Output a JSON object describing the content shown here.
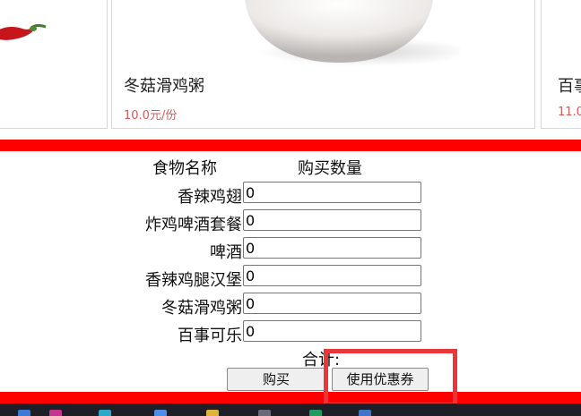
{
  "products": [
    {
      "name": "",
      "price": ""
    },
    {
      "name": "冬菇滑鸡粥",
      "price": "10.0元/份"
    },
    {
      "name": "百事",
      "price": "11.0"
    }
  ],
  "order": {
    "col_name": "食物名称",
    "col_qty": "购买数量",
    "items": [
      {
        "name": "香辣鸡翅",
        "qty": "0"
      },
      {
        "name": "炸鸡啤酒套餐",
        "qty": "0"
      },
      {
        "name": "啤酒",
        "qty": "0"
      },
      {
        "name": "香辣鸡腿汉堡",
        "qty": "0"
      },
      {
        "name": "冬菇滑鸡粥",
        "qty": "0"
      },
      {
        "name": "百事可乐",
        "qty": "0"
      }
    ],
    "total_label": "合计:",
    "buy_label": "购买",
    "coupon_label": "使用优惠券"
  },
  "colors": {
    "accent_red": "#ff0000",
    "price_red": "#d25b5b",
    "highlight_box": "#e8363b",
    "taskbar": "#1e1f26"
  },
  "icons": [
    "chili-pepper-image",
    "porridge-bowl-image",
    "taskbar-app-icon"
  ]
}
